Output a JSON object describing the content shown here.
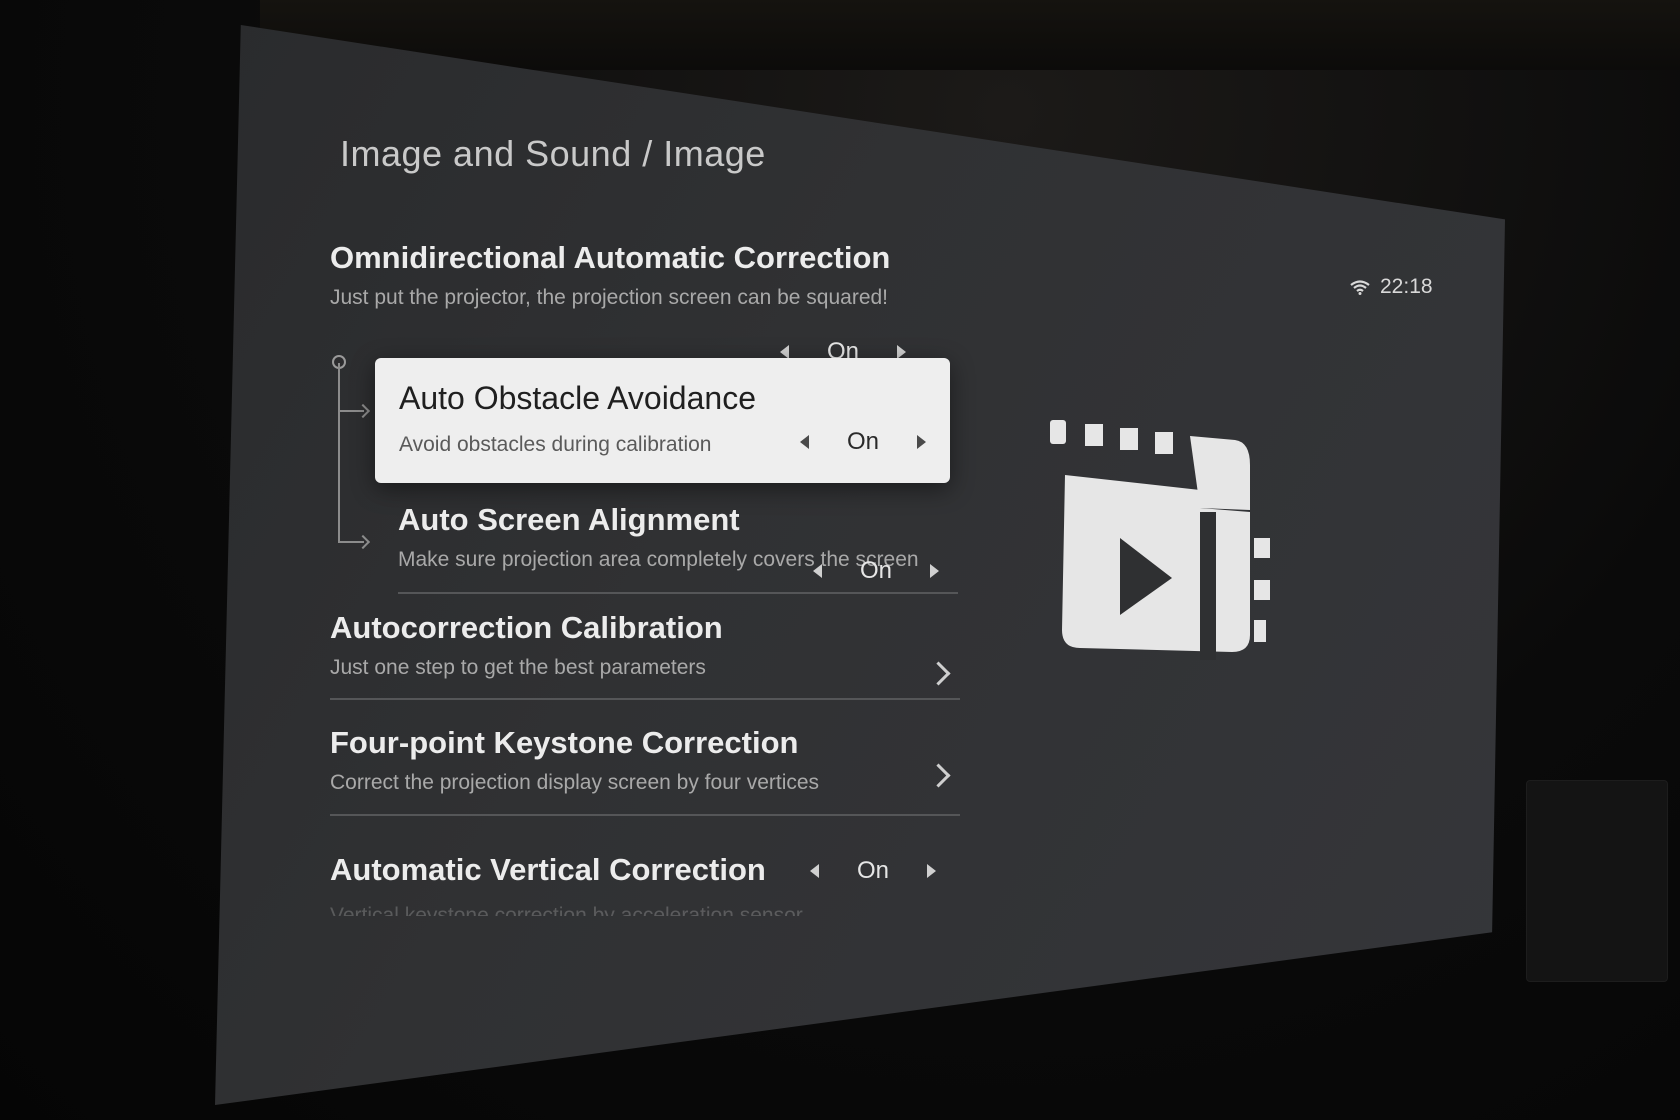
{
  "header": {
    "breadcrumb": "Image and Sound / Image",
    "time": "22:18",
    "wifi_icon": "wifi-icon"
  },
  "menu": {
    "omnidirectional": {
      "title": "Omnidirectional Automatic Correction",
      "description": "Just put the projector, the projection screen can be squared!",
      "value": "On"
    },
    "obstacle": {
      "title": "Auto Obstacle Avoidance",
      "description": "Avoid obstacles during calibration",
      "value": "On"
    },
    "alignment": {
      "title": "Auto Screen Alignment",
      "description": "Make sure projection area completely covers the screen",
      "value": "On"
    },
    "calibration": {
      "title": "Autocorrection Calibration",
      "description": "Just one step to get the best parameters"
    },
    "keystone": {
      "title": "Four-point Keystone Correction",
      "description": "Correct the projection display screen by four vertices"
    },
    "vertical": {
      "title": "Automatic Vertical Correction",
      "description": "Vertical keystone correction by acceleration sensor",
      "value": "On"
    }
  },
  "illustration": {
    "icon": "film-play-icon"
  },
  "colors": {
    "screen_bg": "#2f3032",
    "focused_bg": "#eeeeee",
    "text_primary": "#ececec",
    "text_secondary": "#a9a9a9"
  }
}
